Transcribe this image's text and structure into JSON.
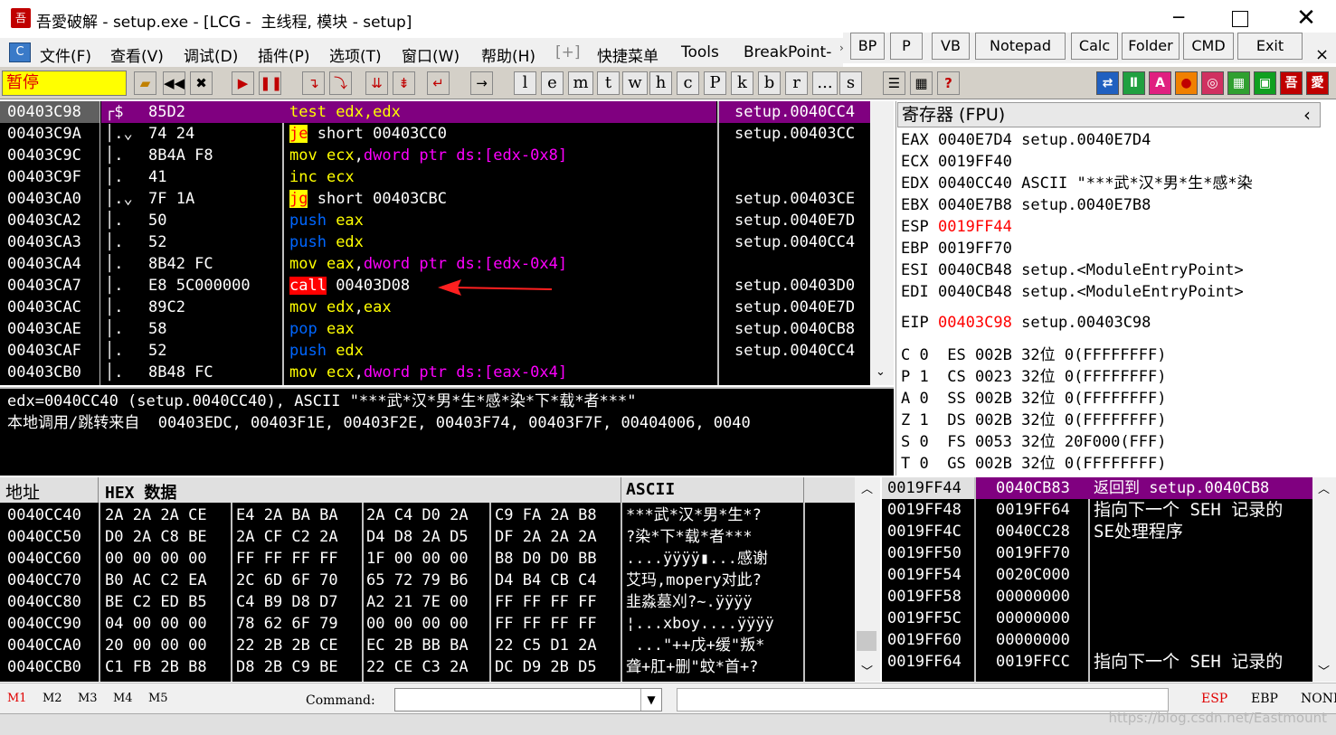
{
  "window": {
    "title": "吾愛破解 - setup.exe - [LCG -  主线程, 模块 - setup]",
    "icon": "wuai-icon",
    "controls": [
      "minimize-icon",
      "maximize-icon",
      "close-icon"
    ]
  },
  "menu": [
    "文件(F)",
    "查看(V)",
    "调试(D)",
    "插件(P)",
    "选项(T)",
    "窗口(W)",
    "帮助(H)",
    "[+]",
    "快捷菜单",
    "Tools",
    "BreakPoint-"
  ],
  "menu_overflow": "›",
  "quick_buttons": [
    "BP",
    "P",
    "VB",
    "Notepad",
    "Calc",
    "Folder",
    "CMD",
    "Exit"
  ],
  "quick_close": "×",
  "toolbar": {
    "status": "暂停",
    "letters": [
      "l",
      "e",
      "m",
      "t",
      "w",
      "h",
      "c",
      "P",
      "k",
      "b",
      "r",
      "...",
      "s"
    ],
    "help": "?",
    "color_glyphs": [
      "⇄",
      "Ⅱ",
      "A",
      "●",
      "◎",
      "▦",
      "▣",
      "吾",
      "愛"
    ]
  },
  "disasm": {
    "selected_addr": "00403C98",
    "rows": [
      {
        "addr": "00403C98",
        "mark": "┌$",
        "hex": "85D2",
        "asm": [
          [
            "test ",
            "y"
          ],
          [
            "edx",
            "y"
          ],
          [
            ",",
            "y"
          ],
          [
            "edx",
            "y"
          ]
        ],
        "cmt": "setup.0040CC4"
      },
      {
        "addr": "00403C9A",
        "mark": "│.⌄",
        "hex": "74 24",
        "asm": [
          [
            "je",
            "jmp"
          ],
          [
            " short 00403CC0",
            "w"
          ]
        ],
        "cmt": "setup.00403CC"
      },
      {
        "addr": "00403C9C",
        "mark": "│.",
        "hex": "8B4A F8",
        "asm": [
          [
            "mov ",
            "y"
          ],
          [
            "ecx",
            "y"
          ],
          [
            ",",
            "w"
          ],
          [
            "dword ptr ds:[edx-0x8]",
            "m"
          ]
        ],
        "cmt": ""
      },
      {
        "addr": "00403C9F",
        "mark": "│.",
        "hex": "41",
        "asm": [
          [
            "inc ",
            "y"
          ],
          [
            "ecx",
            "y"
          ]
        ],
        "cmt": ""
      },
      {
        "addr": "00403CA0",
        "mark": "│.⌄",
        "hex": "7F 1A",
        "asm": [
          [
            "jg",
            "jmp"
          ],
          [
            " short 00403CBC",
            "w"
          ]
        ],
        "cmt": "setup.00403CE"
      },
      {
        "addr": "00403CA2",
        "mark": "│.",
        "hex": "50",
        "asm": [
          [
            "push ",
            "b"
          ],
          [
            "eax",
            "y"
          ]
        ],
        "cmt": "setup.0040E7D"
      },
      {
        "addr": "00403CA3",
        "mark": "│.",
        "hex": "52",
        "asm": [
          [
            "push ",
            "b"
          ],
          [
            "edx",
            "y"
          ]
        ],
        "cmt": "setup.0040CC4"
      },
      {
        "addr": "00403CA4",
        "mark": "│.",
        "hex": "8B42 FC",
        "asm": [
          [
            "mov ",
            "y"
          ],
          [
            "eax",
            "y"
          ],
          [
            ",",
            "w"
          ],
          [
            "dword ptr ds:[edx-0x4]",
            "m"
          ]
        ],
        "cmt": ""
      },
      {
        "addr": "00403CA7",
        "mark": "│.",
        "hex": "E8 5C000000",
        "asm": [
          [
            "call",
            "call"
          ],
          [
            " 00403D08",
            "w"
          ]
        ],
        "cmt": "setup.00403D0"
      },
      {
        "addr": "00403CAC",
        "mark": "│.",
        "hex": "89C2",
        "asm": [
          [
            "mov ",
            "y"
          ],
          [
            "edx",
            "y"
          ],
          [
            ",",
            "w"
          ],
          [
            "eax",
            "y"
          ]
        ],
        "cmt": "setup.0040E7D"
      },
      {
        "addr": "00403CAE",
        "mark": "│.",
        "hex": "58",
        "asm": [
          [
            "pop ",
            "b"
          ],
          [
            "eax",
            "y"
          ]
        ],
        "cmt": "setup.0040CB8"
      },
      {
        "addr": "00403CAF",
        "mark": "│.",
        "hex": "52",
        "asm": [
          [
            "push ",
            "b"
          ],
          [
            "edx",
            "y"
          ]
        ],
        "cmt": "setup.0040CC4"
      },
      {
        "addr": "00403CB0",
        "mark": "│.",
        "hex": "8B48 FC",
        "asm": [
          [
            "mov ",
            "y"
          ],
          [
            "ecx",
            "y"
          ],
          [
            ",",
            "w"
          ],
          [
            "dword ptr ds:[eax-0x4]",
            "m"
          ]
        ],
        "cmt": ""
      }
    ]
  },
  "info": {
    "line1": "edx=0040CC40 (setup.0040CC40), ASCII \"***武*汉*男*生*感*染*下*载*者***\"",
    "line2": "本地调用/跳转来自  00403EDC, 00403F1E, 00403F2E, 00403F74, 00403F7F, 00404006, 0040"
  },
  "registers": {
    "title": "寄存器 (FPU)",
    "collapse": "‹",
    "list": [
      {
        "name": "EAX",
        "value": "0040E7D4",
        "note": "setup.0040E7D4",
        "changed": false
      },
      {
        "name": "ECX",
        "value": "0019FF40",
        "note": "",
        "changed": false
      },
      {
        "name": "EDX",
        "value": "0040CC40",
        "note": "ASCII \"***武*汉*男*生*感*染",
        "changed": false
      },
      {
        "name": "EBX",
        "value": "0040E7B8",
        "note": "setup.0040E7B8",
        "changed": false
      },
      {
        "name": "ESP",
        "value": "0019FF44",
        "note": "",
        "changed": true
      },
      {
        "name": "EBP",
        "value": "0019FF70",
        "note": "",
        "changed": false
      },
      {
        "name": "ESI",
        "value": "0040CB48",
        "note": "setup.<ModuleEntryPoint>",
        "changed": false
      },
      {
        "name": "EDI",
        "value": "0040CB48",
        "note": "setup.<ModuleEntryPoint>",
        "changed": false
      }
    ],
    "eip": {
      "name": "EIP",
      "value": "00403C98",
      "note": "setup.00403C98"
    },
    "flags": [
      {
        "f": "C",
        "v": "0",
        "seg": "ES",
        "sel": "002B",
        "bits": "32位",
        "base": "0(FFFFFFFF)"
      },
      {
        "f": "P",
        "v": "1",
        "seg": "CS",
        "sel": "0023",
        "bits": "32位",
        "base": "0(FFFFFFFF)"
      },
      {
        "f": "A",
        "v": "0",
        "seg": "SS",
        "sel": "002B",
        "bits": "32位",
        "base": "0(FFFFFFFF)"
      },
      {
        "f": "Z",
        "v": "1",
        "seg": "DS",
        "sel": "002B",
        "bits": "32位",
        "base": "0(FFFFFFFF)"
      },
      {
        "f": "S",
        "v": "0",
        "seg": "FS",
        "sel": "0053",
        "bits": "32位",
        "base": "20F000(FFF)"
      },
      {
        "f": "T",
        "v": "0",
        "seg": "GS",
        "sel": "002B",
        "bits": "32位",
        "base": "0(FFFFFFFF)"
      }
    ]
  },
  "dump": {
    "headers": {
      "addr": "地址",
      "hex": "HEX 数据",
      "ascii": "ASCII"
    },
    "rows": [
      {
        "addr": "0040CC40",
        "hex": [
          "2A 2A 2A CE",
          "E4 2A BA BA",
          "2A C4 D0 2A",
          "C9 FA 2A B8"
        ],
        "ascii": "***武*汉*男*生*?"
      },
      {
        "addr": "0040CC50",
        "hex": [
          "D0 2A C8 BE",
          "2A CF C2 2A",
          "D4 D8 2A D5",
          "DF 2A 2A 2A"
        ],
        "ascii": "?染*下*载*者***"
      },
      {
        "addr": "0040CC60",
        "hex": [
          "00 00 00 00",
          "FF FF FF FF",
          "1F 00 00 00",
          "B8 D0 D0 BB"
        ],
        "ascii": "....ÿÿÿÿ▮...感谢"
      },
      {
        "addr": "0040CC70",
        "hex": [
          "B0 AC C2 EA",
          "2C 6D 6F 70",
          "65 72 79 B6",
          "D4 B4 CB C4"
        ],
        "ascii": "艾玛,mopery对此?"
      },
      {
        "addr": "0040CC80",
        "hex": [
          "BE C2 ED B5",
          "C4 B9 D8 D7",
          "A2 21 7E 00",
          "FF FF FF FF"
        ],
        "ascii": "韭淼墓刈?~.ÿÿÿÿ"
      },
      {
        "addr": "0040CC90",
        "hex": [
          "04 00 00 00",
          "78 62 6F 79",
          "00 00 00 00",
          "FF FF FF FF"
        ],
        "ascii": "¦...xboy....ÿÿÿÿ"
      },
      {
        "addr": "0040CCA0",
        "hex": [
          "20 00 00 00",
          "22 2B 2B CE",
          "EC 2B BB BA",
          "22 C5 D1 2A"
        ],
        "ascii": " ...\"++戊+缓\"叛*"
      },
      {
        "addr": "0040CCB0",
        "hex": [
          "C1 FB 2B B8",
          "D8 2B C9 BE",
          "22 CE C3 2A",
          "DC D9 2B D5"
        ],
        "ascii": "聋+肛+删\"蚊*首+?"
      }
    ]
  },
  "stack": {
    "rows": [
      {
        "addr": "0019FF44",
        "val": "0040CB83",
        "cmt": "返回到 setup.0040CB8",
        "sel": true
      },
      {
        "addr": "0019FF48",
        "val": "0019FF64",
        "cmt": "指向下一个 SEH 记录的",
        "sel": false
      },
      {
        "addr": "0019FF4C",
        "val": "0040CC28",
        "cmt": "SE处理程序",
        "sel": false
      },
      {
        "addr": "0019FF50",
        "val": "0019FF70",
        "cmt": "",
        "sel": false
      },
      {
        "addr": "0019FF54",
        "val": "0020C000",
        "cmt": "",
        "sel": false
      },
      {
        "addr": "0019FF58",
        "val": "00000000",
        "cmt": "",
        "sel": false
      },
      {
        "addr": "0019FF5C",
        "val": "00000000",
        "cmt": "",
        "sel": false
      },
      {
        "addr": "0019FF60",
        "val": "00000000",
        "cmt": "",
        "sel": false
      },
      {
        "addr": "0019FF64",
        "val": "0019FFCC",
        "cmt": "指向下一个 SEH 记录的",
        "sel": false
      }
    ]
  },
  "command": {
    "tabs": [
      "M1",
      "M2",
      "M3",
      "M4",
      "M5"
    ],
    "label": "Command:",
    "value": "",
    "reg_tabs": [
      "ESP",
      "EBP",
      "NONE"
    ]
  },
  "watermark": "https://blog.csdn.net/Eastmount",
  "colors": {
    "accent": "#800080",
    "changed_reg": "#ff0000",
    "jump_bg": "#ffff00",
    "call_bg": "#ff0000",
    "status_bg": "#ffff00"
  }
}
